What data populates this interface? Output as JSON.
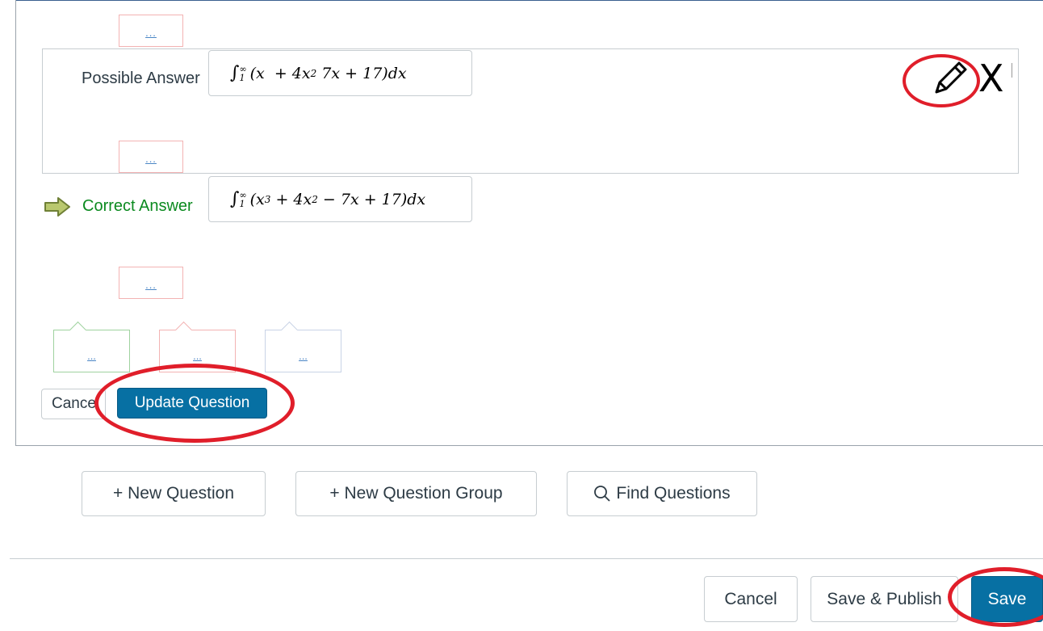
{
  "question_editor": {
    "comment_link": "...",
    "possible_answer": {
      "label": "Possible Answer",
      "formula_parts": [
        "∫",
        "1",
        "∞",
        "(x  + 4x",
        "2",
        " 7x + 17)dx"
      ]
    },
    "correct_answer": {
      "label": "Correct Answer",
      "formula_parts": [
        "∫",
        "1",
        "∞",
        "(x",
        "3",
        " + 4x",
        "2",
        " − 7x + 17)dx"
      ]
    },
    "delete_label": "X",
    "feedback_links": [
      "...",
      "...",
      "..."
    ],
    "cancel_label": "Cance",
    "update_label": "Update Question"
  },
  "question_actions": {
    "new_question": "+ New Question",
    "new_question_group": "+ New Question Group",
    "find_questions": "Find Questions"
  },
  "footer": {
    "cancel": "Cancel",
    "save_publish": "Save & Publish",
    "save": "Save"
  },
  "colors": {
    "primary": "#0770a3",
    "correct": "#0b8a1f",
    "annotation": "#e01e2a"
  },
  "icons": [
    "pencil-icon",
    "arrow-right-icon",
    "search-icon"
  ]
}
